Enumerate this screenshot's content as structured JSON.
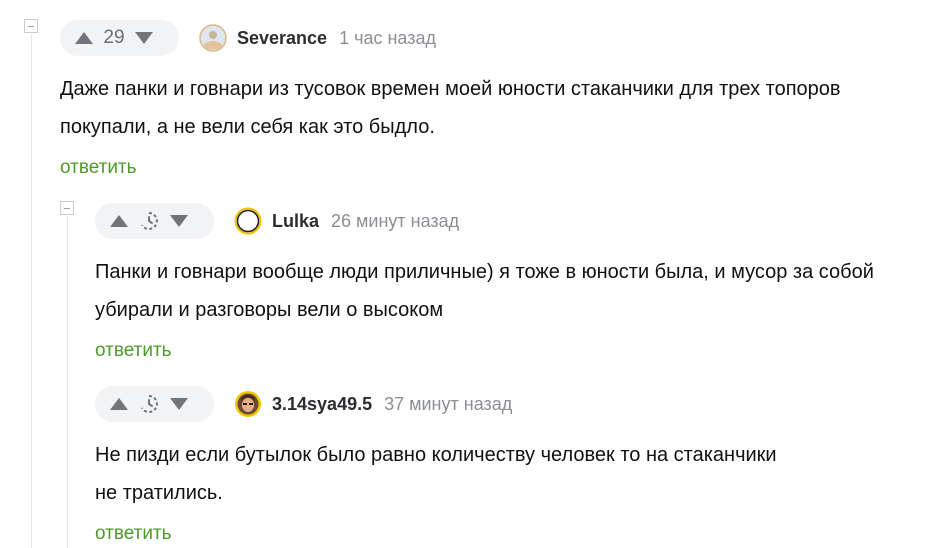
{
  "comments": [
    {
      "rating": "29",
      "username": "Severance",
      "time": "1 час назад",
      "text_lines": [
        "Даже панки и говнари из тусовок времен моей юности стаканчики для трех топоров",
        "покупали, а не вели себя как это быдло."
      ],
      "reply_label": "ответить",
      "avatar_icon": "avatar-sketch-icon"
    },
    {
      "rating": "",
      "username": "Lulka",
      "time": "26 минут назад",
      "text_lines": [
        "Панки и говнари вообще люди приличные) я тоже в юности была, и мусор за собой",
        "убирали и разговоры вели о высоком"
      ],
      "reply_label": "ответить",
      "avatar_icon": "avatar-ring-icon"
    },
    {
      "rating": "",
      "username": "3.14sya49.5",
      "time": "37 минут назад",
      "text_lines": [
        "Не пизди если бутылок было равно количеству человек то на стаканчики",
        "не тратились."
      ],
      "reply_label": "ответить",
      "avatar_icon": "avatar-portrait-icon"
    }
  ],
  "colors": {
    "reply_link": "#4e9a2a",
    "vote_pill_bg": "#f2f3f5",
    "thread_line": "#e4e6e9"
  }
}
